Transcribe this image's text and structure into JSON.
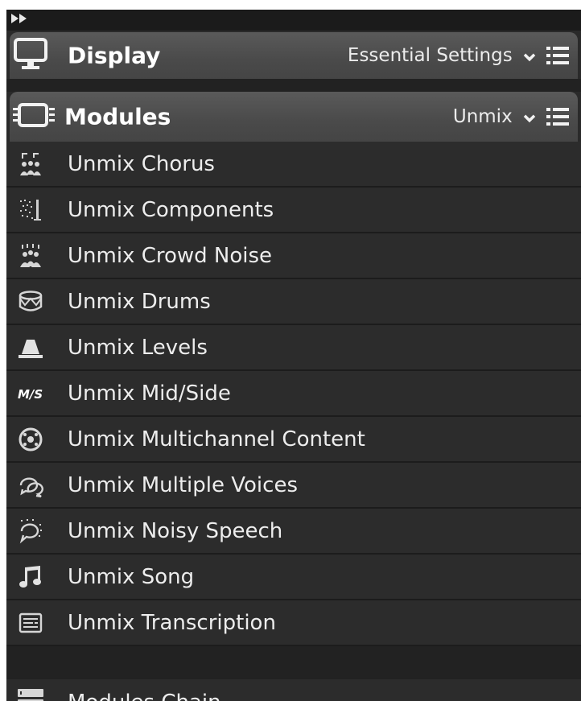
{
  "display": {
    "title": "Display",
    "preset": "Essential Settings"
  },
  "modules": {
    "title": "Modules",
    "preset": "Unmix",
    "items": [
      {
        "label": "Unmix Chorus",
        "icon": "chorus-icon"
      },
      {
        "label": "Unmix Components",
        "icon": "components-icon"
      },
      {
        "label": "Unmix Crowd Noise",
        "icon": "crowd-noise-icon"
      },
      {
        "label": "Unmix Drums",
        "icon": "drum-icon"
      },
      {
        "label": "Unmix Levels",
        "icon": "levels-icon"
      },
      {
        "label": "Unmix Mid/Side",
        "icon": "mid-side-icon",
        "icon_text": "M/S"
      },
      {
        "label": "Unmix Multichannel Content",
        "icon": "multichannel-icon"
      },
      {
        "label": "Unmix Multiple Voices",
        "icon": "multiple-voices-icon"
      },
      {
        "label": "Unmix Noisy Speech",
        "icon": "noisy-speech-icon"
      },
      {
        "label": "Unmix Song",
        "icon": "music-note-icon"
      },
      {
        "label": "Unmix Transcription",
        "icon": "transcription-icon"
      }
    ]
  },
  "chain": {
    "label": "Modules Chain",
    "icon": "modules-chain-icon"
  },
  "colors": {
    "panel_bg": "#2a2a2a",
    "header_bg": "#4a4a4a",
    "text": "#ededed"
  }
}
